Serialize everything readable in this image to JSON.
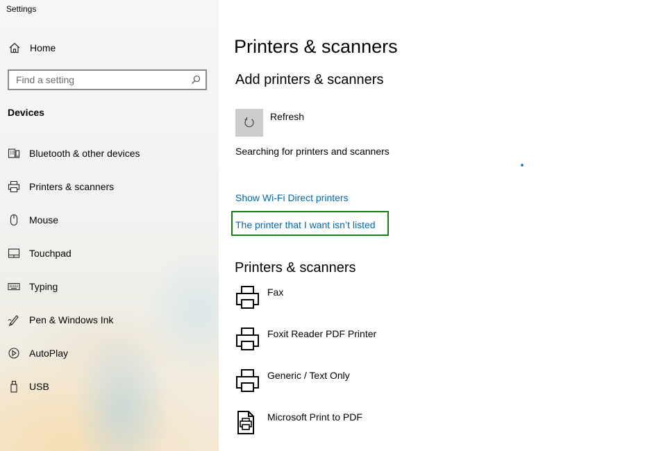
{
  "window": {
    "title": "Settings"
  },
  "sidebar": {
    "home_label": "Home",
    "search": {
      "placeholder": "Find a setting",
      "value": ""
    },
    "section_title": "Devices",
    "items": [
      {
        "label": "Bluetooth & other devices",
        "icon": "bluetooth-devices-icon"
      },
      {
        "label": "Printers & scanners",
        "icon": "printer-icon"
      },
      {
        "label": "Mouse",
        "icon": "mouse-icon"
      },
      {
        "label": "Touchpad",
        "icon": "touchpad-icon"
      },
      {
        "label": "Typing",
        "icon": "keyboard-icon"
      },
      {
        "label": "Pen & Windows Ink",
        "icon": "pen-icon"
      },
      {
        "label": "AutoPlay",
        "icon": "autoplay-icon"
      },
      {
        "label": "USB",
        "icon": "usb-icon"
      }
    ]
  },
  "main": {
    "page_title": "Printers & scanners",
    "add_section_title": "Add printers & scanners",
    "refresh_label": "Refresh",
    "searching_text": "Searching for printers and scanners",
    "links": {
      "wifi_direct": "Show Wi-Fi Direct printers",
      "not_listed": "The printer that I want isn’t listed"
    },
    "list_section_title": "Printers & scanners",
    "printers": [
      {
        "label": "Fax",
        "icon": "printer-icon"
      },
      {
        "label": "Foxit Reader PDF Printer",
        "icon": "printer-icon"
      },
      {
        "label": "Generic / Text Only",
        "icon": "printer-icon"
      },
      {
        "label": "Microsoft Print to PDF",
        "icon": "pdf-printer-icon"
      }
    ]
  },
  "colors": {
    "link": "#0067b8",
    "highlight_border": "#1a7a1a",
    "accent": "#2b74d6"
  }
}
